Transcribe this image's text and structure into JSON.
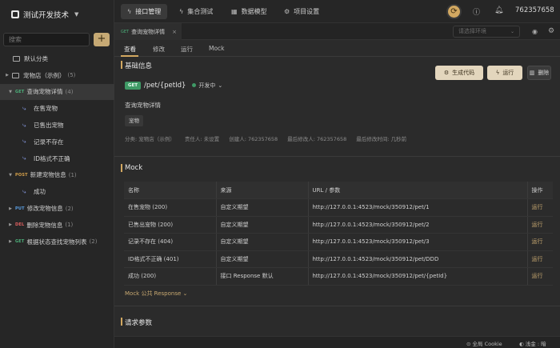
{
  "project": {
    "name": "测试开发技术"
  },
  "sidebar": {
    "search_placeholder": "搜索",
    "add_label": "+",
    "default_category": "默认分类",
    "folder": {
      "name": "宠物店（示例）",
      "count": "(5)"
    },
    "items": [
      {
        "method": "GET",
        "name": "查询宠物详情",
        "count": "(4)",
        "selected": true
      },
      {
        "name": "在售宠物",
        "type": "mock"
      },
      {
        "name": "已售出宠物",
        "type": "mock"
      },
      {
        "name": "记录不存在",
        "type": "mock"
      },
      {
        "name": "ID格式不正确",
        "type": "mock"
      },
      {
        "method": "POST",
        "name": "新建宠物信息",
        "count": "(1)"
      },
      {
        "name": "成功",
        "type": "mock"
      },
      {
        "method": "PUT",
        "name": "修改宠物信息",
        "count": "(2)"
      },
      {
        "method": "DEL",
        "name": "删除宠物信息",
        "count": "(1)"
      },
      {
        "method": "GET",
        "name": "根据状态查找宠物列表",
        "count": "(2)"
      }
    ]
  },
  "topbar": {
    "nav": [
      "接口管理",
      "集合测试",
      "数据模型",
      "项目设置"
    ],
    "user_id": "762357658"
  },
  "tabstrip": {
    "tab": {
      "method": "GET",
      "title": "查询宠物详情",
      "close": "×"
    },
    "env_placeholder": "请选择环境"
  },
  "subtabs": [
    "查看",
    "修改",
    "运行",
    "Mock"
  ],
  "basic": {
    "title": "基础信息",
    "method": "GET",
    "path": "/pet/{petId}",
    "status": "开发中",
    "description": "查询宠物详情",
    "tag": "宠物",
    "meta": [
      "分类: 宠物店（示例）",
      "责任人: 未设置",
      "创建人: 762357658",
      "最后修改人: 762357658",
      "最后修改时间: 几秒前"
    ],
    "buttons": {
      "generate": "生成代码",
      "run": "运行",
      "save": "删除"
    }
  },
  "mock": {
    "title": "Mock",
    "headers": [
      "名称",
      "来源",
      "URL / 参数",
      "操作"
    ],
    "rows": [
      {
        "name": "在售宠物 (200)",
        "source": "自定义期望",
        "url": "http://127.0.0.1:4523/mock/350912/pet/1",
        "op": "运行"
      },
      {
        "name": "已售出宠物 (200)",
        "source": "自定义期望",
        "url": "http://127.0.0.1:4523/mock/350912/pet/2",
        "op": "运行"
      },
      {
        "name": "记录不存在 (404)",
        "source": "自定义期望",
        "url": "http://127.0.0.1:4523/mock/350912/pet/3",
        "op": "运行"
      },
      {
        "name": "ID格式不正确 (401)",
        "source": "自定义期望",
        "url": "http://127.0.0.1:4523/mock/350912/pet/DDD",
        "op": "运行"
      },
      {
        "name": "成功 (200)",
        "source": "接口 Response 默认",
        "url": "http://127.0.0.1:4523/mock/350912/pet/{petId}",
        "op": "运行"
      }
    ],
    "public_link": "Mock 公共 Response"
  },
  "params": {
    "title": "请求参数"
  },
  "statusbar": {
    "cookie": "全局 Cookie",
    "lang": "浅金 : 暗"
  },
  "colors": {
    "accent": "#d2a861",
    "get": "#3f9a66",
    "post": "#d6a14a",
    "put": "#5a9de0",
    "delete": "#e06060"
  }
}
